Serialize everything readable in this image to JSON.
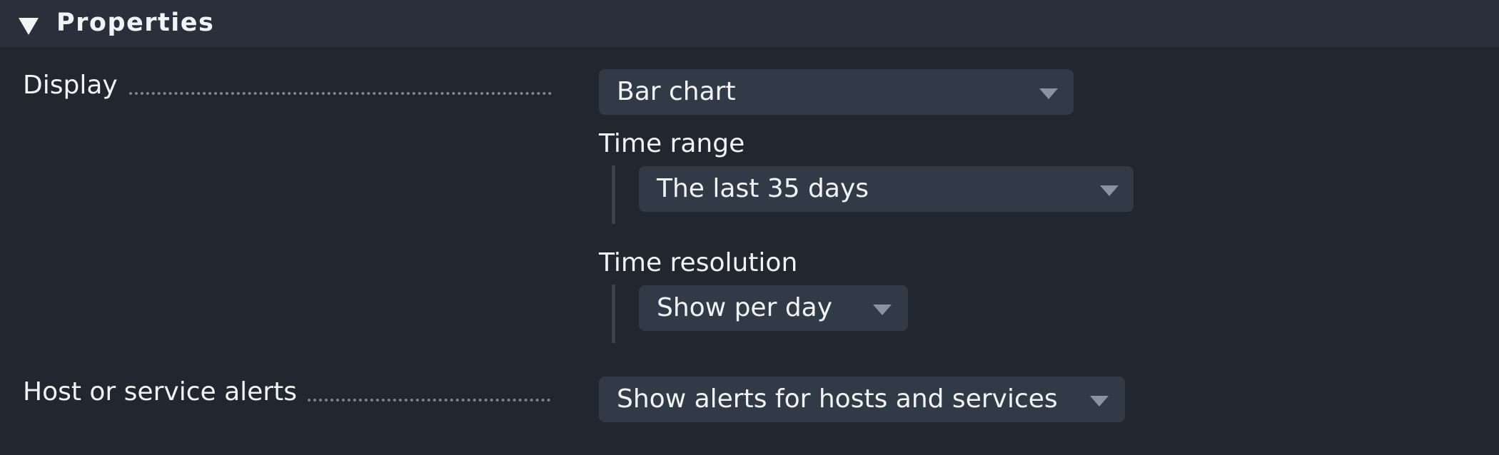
{
  "section": {
    "title": "Properties",
    "collapse_icon": "triangle-down-icon"
  },
  "display": {
    "label": "Display",
    "value": "Bar chart",
    "time_range": {
      "label": "Time range",
      "value": "The last 35 days"
    },
    "time_resolution": {
      "label": "Time resolution",
      "value": "Show per day"
    }
  },
  "alerts": {
    "label": "Host or service alerts",
    "value": "Show alerts for hosts and services"
  },
  "icons": {
    "dropdown": "chevron-down-icon"
  },
  "colors": {
    "background": "#21262f",
    "header": "#29303b",
    "select": "#313a47",
    "text": "#f1f3f5",
    "chevron": "#8c939e"
  }
}
